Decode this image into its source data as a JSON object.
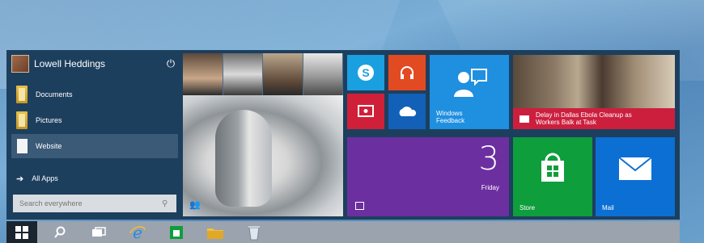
{
  "user": {
    "name": "Lowell Heddings"
  },
  "nav": {
    "items": [
      {
        "label": "Documents"
      },
      {
        "label": "Pictures"
      },
      {
        "label": "Website"
      }
    ],
    "all_apps": "All Apps"
  },
  "search": {
    "placeholder": "Search everywhere"
  },
  "tiles": {
    "feedback": "Windows Feedback",
    "news": "Delay in Dallas Ebola Cleanup as Workers Balk at Task",
    "calendar_num": "3",
    "calendar_day": "Friday",
    "store": "Store",
    "mail": "Mail"
  },
  "colors": {
    "skype": "#1aa0e0",
    "music": "#e24a22",
    "video": "#d02039",
    "onedrive": "#1260b8",
    "feedback": "#1f8fe0",
    "news": "#cc1f3e",
    "calendar": "#6c2fa0",
    "store": "#0e9e3c",
    "mail": "#0b6fd3"
  },
  "taskbar": {
    "icons": [
      "windows-icon",
      "search-icon",
      "task-view-icon",
      "internet-explorer-icon",
      "store-icon",
      "file-explorer-icon",
      "recycle-bin-icon"
    ]
  }
}
